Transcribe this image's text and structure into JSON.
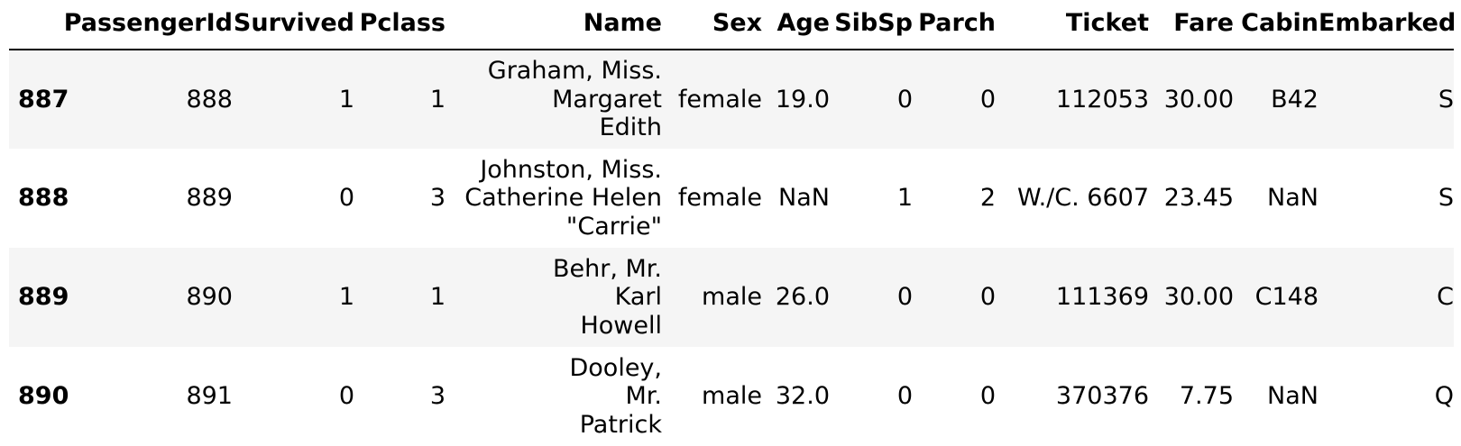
{
  "table": {
    "columns": [
      "PassengerId",
      "Survived",
      "Pclass",
      "Name",
      "Sex",
      "Age",
      "SibSp",
      "Parch",
      "Ticket",
      "Fare",
      "Cabin",
      "Embarked"
    ],
    "rows": [
      {
        "index": "887",
        "PassengerId": "888",
        "Survived": "1",
        "Pclass": "1",
        "Name": [
          "Graham, Miss.",
          "Margaret",
          "Edith"
        ],
        "Sex": "female",
        "Age": "19.0",
        "SibSp": "0",
        "Parch": "0",
        "Ticket": "112053",
        "Fare": "30.00",
        "Cabin": "B42",
        "Embarked": "S"
      },
      {
        "index": "888",
        "PassengerId": "889",
        "Survived": "0",
        "Pclass": "3",
        "Name": [
          "Johnston, Miss.",
          "Catherine Helen",
          "\"Carrie\""
        ],
        "Sex": "female",
        "Age": "NaN",
        "SibSp": "1",
        "Parch": "2",
        "Ticket": "W./C. 6607",
        "Fare": "23.45",
        "Cabin": "NaN",
        "Embarked": "S"
      },
      {
        "index": "889",
        "PassengerId": "890",
        "Survived": "1",
        "Pclass": "1",
        "Name": [
          "Behr, Mr.",
          "Karl",
          "Howell"
        ],
        "Sex": "male",
        "Age": "26.0",
        "SibSp": "0",
        "Parch": "0",
        "Ticket": "111369",
        "Fare": "30.00",
        "Cabin": "C148",
        "Embarked": "C"
      },
      {
        "index": "890",
        "PassengerId": "891",
        "Survived": "0",
        "Pclass": "3",
        "Name": [
          "Dooley,",
          "Mr.",
          "Patrick"
        ],
        "Sex": "male",
        "Age": "32.0",
        "SibSp": "0",
        "Parch": "0",
        "Ticket": "370376",
        "Fare": "7.75",
        "Cabin": "NaN",
        "Embarked": "Q"
      }
    ]
  }
}
